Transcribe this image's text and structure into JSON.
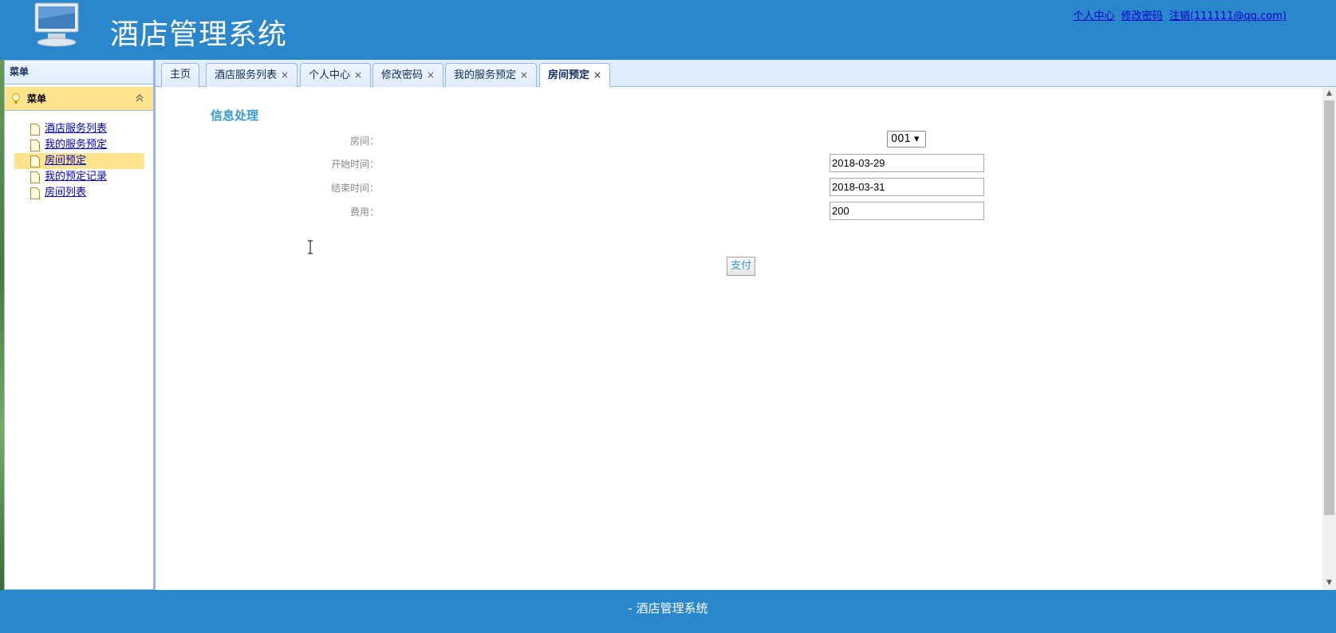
{
  "header": {
    "title": "酒店管理系统",
    "links": {
      "profile": "个人中心",
      "change_password": "修改密码",
      "logout": "注销(111111@qq.com)"
    }
  },
  "sidebar": {
    "title": "菜单",
    "accordion_title": "菜单",
    "items": [
      {
        "label": "酒店服务列表"
      },
      {
        "label": "我的服务预定"
      },
      {
        "label": "房间预定"
      },
      {
        "label": "我的预定记录"
      },
      {
        "label": "房间列表"
      }
    ],
    "active_index": 2
  },
  "tabs": [
    {
      "label": "主页",
      "closable": false
    },
    {
      "label": "酒店服务列表",
      "closable": true
    },
    {
      "label": "个人中心",
      "closable": true
    },
    {
      "label": "修改密码",
      "closable": true
    },
    {
      "label": "我的服务预定",
      "closable": true
    },
    {
      "label": "房间预定",
      "closable": true,
      "selected": true
    }
  ],
  "tab_close_glyph": "×",
  "form": {
    "section_title": "信息处理",
    "room_label": "房间：",
    "room_value": "001 ▾",
    "start_label": "开始时间：",
    "start_value": "2018-03-29",
    "end_label": "结束时间：",
    "end_value": "2018-03-31",
    "fee_label": "费用：",
    "fee_value": "200",
    "pay_button": "支付"
  },
  "footer": {
    "text": "- 酒店管理系统"
  },
  "colors": {
    "brand": "#2b87cc",
    "accent_yellow": "#ffe48d",
    "panel_border": "#95b8e7",
    "section_title": "#3a9bd5"
  },
  "icons": {
    "logo": "monitor-icon",
    "accordion": "lightbulb-icon",
    "collapse": "double-chevron-up-icon",
    "menu_item": "document-icon"
  }
}
